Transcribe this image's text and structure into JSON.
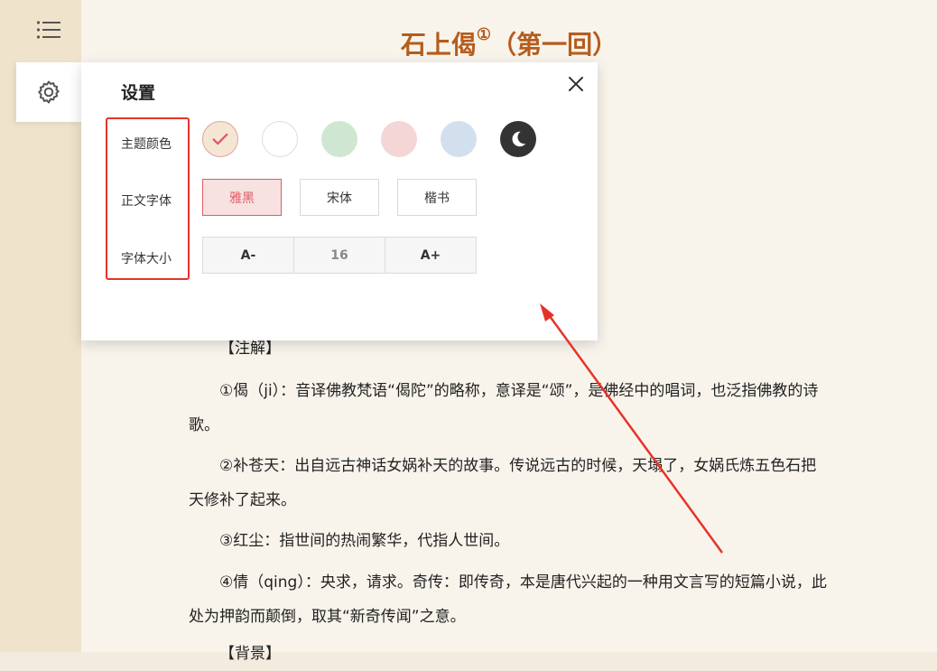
{
  "colors": {
    "accent": "#e05a66",
    "title": "#b65c1c",
    "highlight_box": "#e6332a"
  },
  "rail": {
    "menu_icon": "list-icon",
    "settings_icon": "gear-icon"
  },
  "document": {
    "title": "石上偈",
    "title_marker": "①",
    "title_suffix": "（第一回）",
    "notes_heading": "【注解】",
    "notes": [
      "①偈（ji）：音译佛教梵语“偈陀”的略称，意译是“颂”，是佛经中的唱词，也泛指佛教的诗歌。",
      "②补苍天：出自远古神话女娲补天的故事。传说远古的时候，天塌了，女娲氏炼五色石把天修补了起来。",
      "③红尘：指世间的热闹繁华，代指人世间。",
      "④倩（qing）：央求，请求。奇传：即传奇，本是唐代兴起的一种用文言写的短篇小说，此处为押韵而颠倒，取其“新奇传闻”之意。"
    ],
    "next_heading": "【背景】"
  },
  "settings": {
    "title": "设置",
    "close_icon": "close-icon",
    "theme_label": "主题颜色",
    "font_label": "正文字体",
    "size_label": "字体大小",
    "themes": [
      {
        "name": "cream",
        "color": "#f5e6d3",
        "selected": true
      },
      {
        "name": "white",
        "color": "#ffffff",
        "selected": false
      },
      {
        "name": "green",
        "color": "#cfe6d2",
        "selected": false
      },
      {
        "name": "pink",
        "color": "#f4d6d6",
        "selected": false
      },
      {
        "name": "blue",
        "color": "#d2e0ee",
        "selected": false
      },
      {
        "name": "night",
        "color": "#333333",
        "selected": false
      }
    ],
    "fonts": [
      "雅黑",
      "宋体",
      "楷书"
    ],
    "selected_font": "雅黑",
    "size_decrease": "A-",
    "size_value": "16",
    "size_increase": "A+"
  }
}
